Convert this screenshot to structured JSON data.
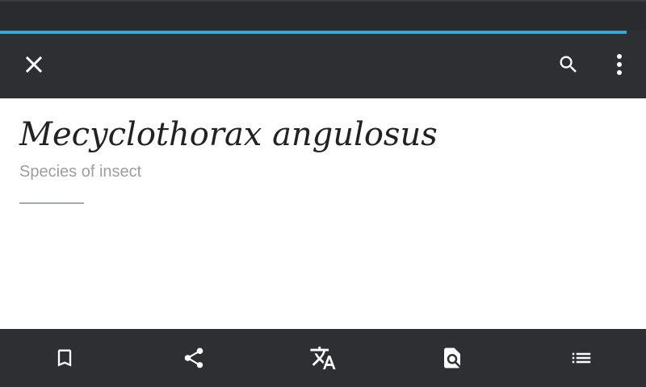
{
  "toolbar": {
    "close_icon": "close-icon",
    "search_icon": "search-icon",
    "overflow_icon": "more-vertical-icon"
  },
  "page": {
    "title": "Mecyclothorax angulosus",
    "subtitle": "Species of insect"
  },
  "load_progress": 0.97,
  "bottom_bar": {
    "items": [
      {
        "icon": "bookmark-icon"
      },
      {
        "icon": "share-icon"
      },
      {
        "icon": "translate-icon"
      },
      {
        "icon": "find-in-page-icon"
      },
      {
        "icon": "table-of-contents-icon"
      }
    ]
  },
  "colors": {
    "toolbar_bg": "#2e2f33",
    "status_bg": "#2a2b2e",
    "progress": "#3aa6d6",
    "title_text": "#222222",
    "subtitle_text": "#9b9ea2",
    "icon": "#ffffff"
  }
}
